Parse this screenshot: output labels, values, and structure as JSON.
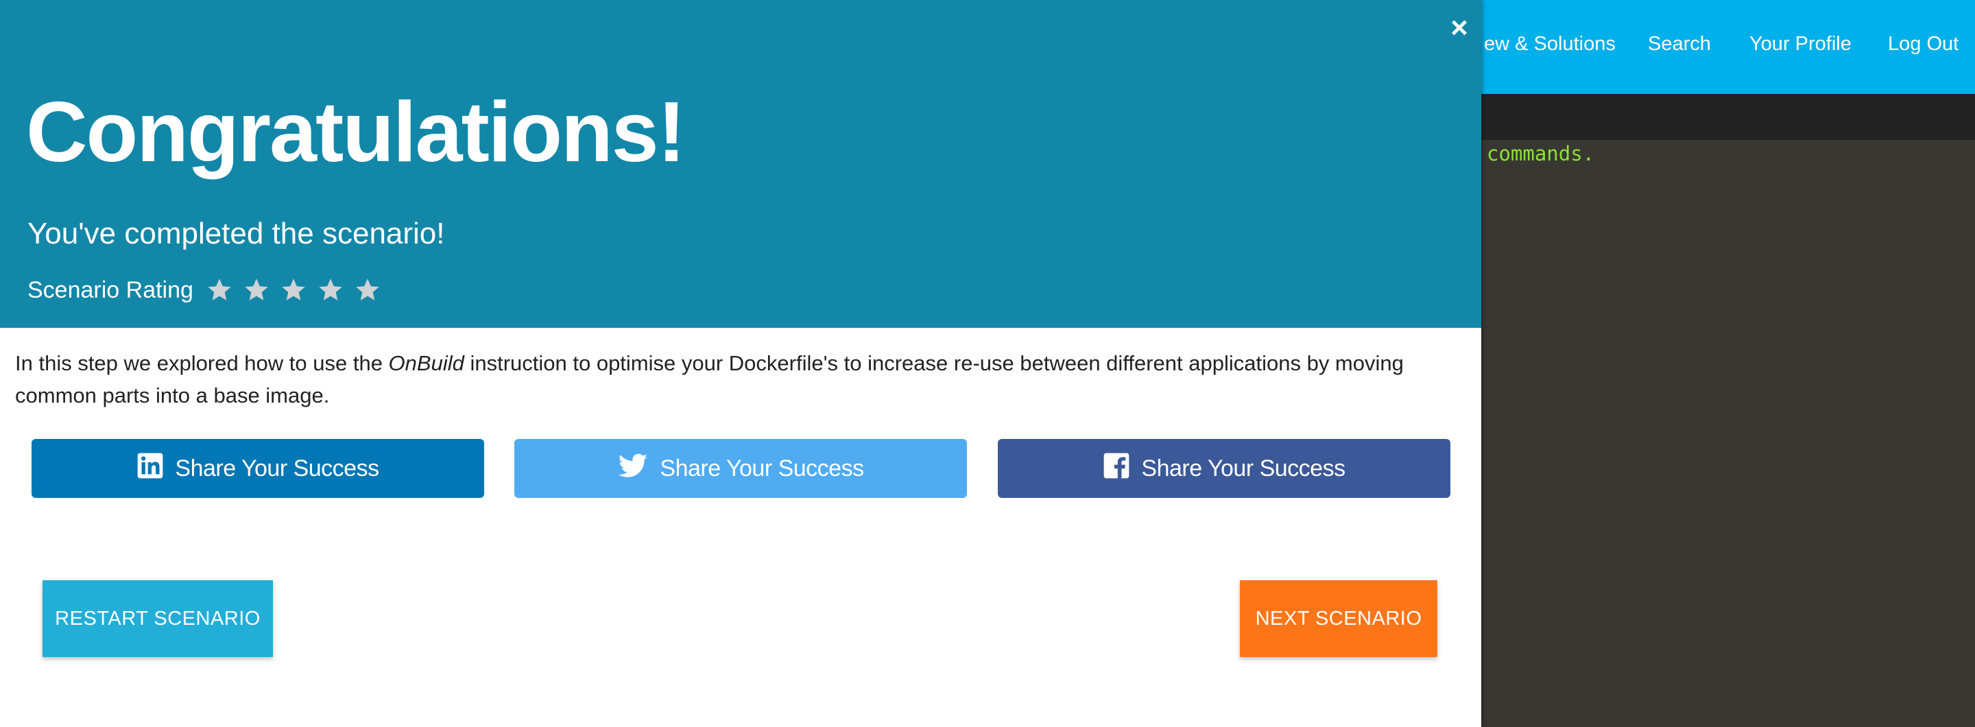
{
  "app": {
    "nav": [
      "ew & Solutions",
      "Search",
      "Your Profile",
      "Log Out"
    ],
    "terminal_text": "commands.",
    "toolbar_icons": [
      "megaphone-icon",
      "expand-icon",
      "gear-icon"
    ],
    "colors": {
      "nav_bg": "#00b0ea",
      "terminal_bar": "#232323",
      "terminal_bg": "#383731",
      "terminal_text": "#8ae234"
    }
  },
  "modal": {
    "close_glyph": "×",
    "title": "Congratulations!",
    "subtitle": "You've completed the scenario!",
    "rating": {
      "label": "Scenario Rating",
      "stars_total": 5,
      "stars_selected": 0
    },
    "summary": {
      "before": "In this step we explored how to use the ",
      "emphasis": "OnBuild",
      "after": " instruction to optimise your Dockerfile's to increase re-use between different applications by moving common parts into a base image."
    },
    "share": {
      "linkedin": {
        "label": "Share Your Success",
        "icon": "linkedin-icon",
        "color": "#0177b5"
      },
      "twitter": {
        "label": "Share Your Success",
        "icon": "twitter-icon",
        "color": "#50abf1"
      },
      "facebook": {
        "label": "Share Your Success",
        "icon": "facebook-icon",
        "color": "#3b5998"
      }
    },
    "restart_label": "RESTART SCENARIO",
    "next_label": "NEXT SCENARIO",
    "colors": {
      "header_bg": "#1387a8",
      "restart": "#23aed8",
      "next": "#fd7519"
    }
  }
}
